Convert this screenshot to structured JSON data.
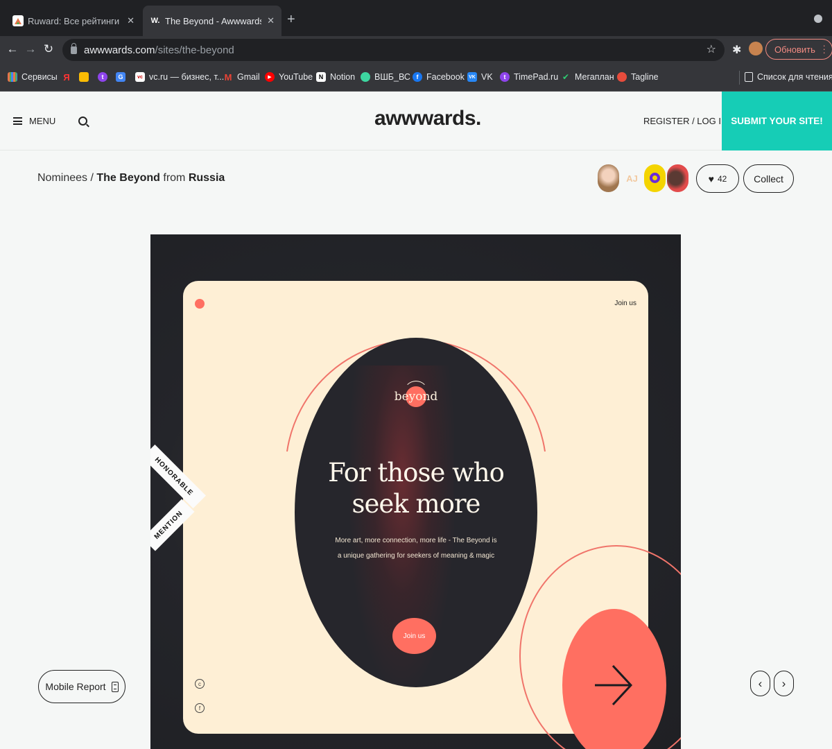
{
  "browser": {
    "tabs": [
      {
        "title": "Ruward: Все рейтинги и анал",
        "active": false
      },
      {
        "title": "The Beyond - Awwwards Nomi",
        "active": true
      }
    ],
    "new_tab_symbol": "+",
    "url_host": "awwwards.com",
    "url_path": "/sites/the-beyond",
    "update_label": "Обновить",
    "bookmarks": [
      {
        "label": "Сервисы",
        "icon": "apps-grid-icon",
        "color": "#e8734a"
      },
      {
        "label": "",
        "icon": "yandex-icon",
        "color": "#f33"
      },
      {
        "label": "",
        "icon": "mail-icon",
        "color": "#fbbc04"
      },
      {
        "label": "",
        "icon": "timepad-icon",
        "color": "#8e44ec"
      },
      {
        "label": "",
        "icon": "translate-icon",
        "color": "#4285f4"
      },
      {
        "label": "vc.ru — бизнес, т...",
        "icon": "vc-icon",
        "color": "#ffffff"
      },
      {
        "label": "Gmail",
        "icon": "gmail-icon",
        "color": "#ea4335"
      },
      {
        "label": "YouTube",
        "icon": "youtube-icon",
        "color": "#ff0000"
      },
      {
        "label": "Notion",
        "icon": "notion-icon",
        "color": "#ffffff"
      },
      {
        "label": "ВШБ_ВС",
        "icon": "vshb-icon",
        "color": "#3dd6a0"
      },
      {
        "label": "Facebook",
        "icon": "facebook-icon",
        "color": "#1877f2"
      },
      {
        "label": "VK",
        "icon": "vk-icon",
        "color": "#2787f5"
      },
      {
        "label": "TimePad.ru",
        "icon": "timepad-icon",
        "color": "#8e44ec"
      },
      {
        "label": "Мегаплан",
        "icon": "megaplan-icon",
        "color": "#2ecc71"
      },
      {
        "label": "Tagline",
        "icon": "tagline-icon",
        "color": "#e74c3c"
      }
    ],
    "reading_list_label": "Список для чтения"
  },
  "header": {
    "menu_label": "MENU",
    "logo": "awwwards.",
    "login_label": "REGISTER / LOG IN",
    "submit_label": "SUBMIT YOUR SITE!"
  },
  "breadcrumb": {
    "section": "Nominees",
    "separator": " / ",
    "site_name": "The Beyond",
    "from_word": " from ",
    "country": "Russia"
  },
  "jurors": [
    {
      "icon": "juror-avatar-1",
      "color": "#c9a48a"
    },
    {
      "icon": "juror-avatar-2",
      "color": "#f5f7f6",
      "initials": "AJ"
    },
    {
      "icon": "juror-avatar-3",
      "color": "#f4d400"
    },
    {
      "icon": "juror-avatar-4",
      "color": "#e24b4b"
    }
  ],
  "likes": {
    "count": "42"
  },
  "collect_label": "Collect",
  "mobile_report_label": "Mobile Report",
  "showcase": {
    "badge_line1": "HONORABLE",
    "badge_line2": "MENTION",
    "card": {
      "top_link": "Join us",
      "brand": "beyond",
      "headline_line1": "For those who",
      "headline_line2": "seek more",
      "subtext": "More art, more connection, more life - The Beyond is a unique gathering for seekers of meaning & magic",
      "cta": "Join us"
    },
    "colors": {
      "accent": "#ff6f61",
      "cream": "#feefd5",
      "dark": "#26262c"
    }
  },
  "nav_arrows": {
    "prev": "‹",
    "next": "›"
  }
}
